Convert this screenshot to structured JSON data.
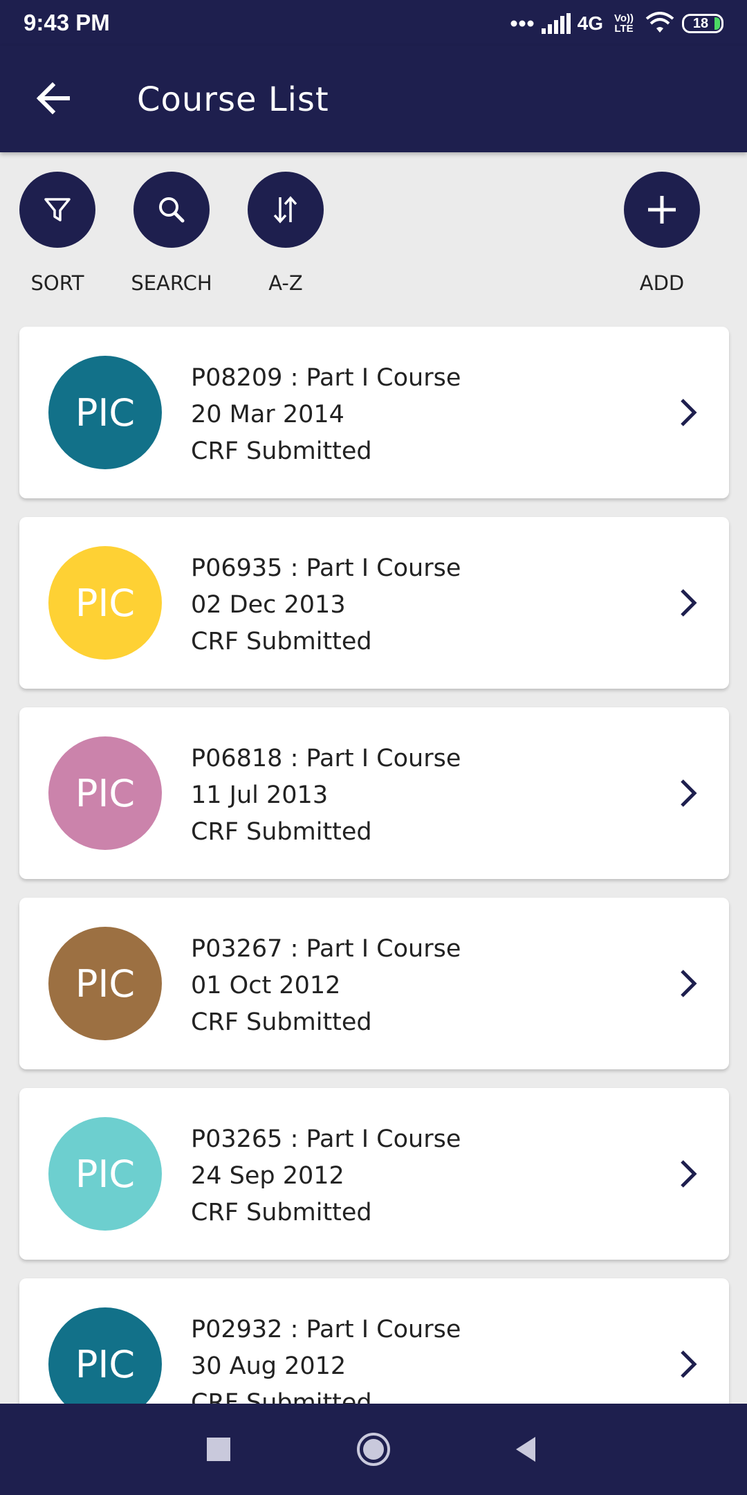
{
  "status_bar": {
    "time": "9:43 PM",
    "network": "4G",
    "network_sub": "Vo)) LTE",
    "battery": "18",
    "icons": [
      "dots-icon",
      "signal-icon",
      "wifi-icon",
      "battery-icon"
    ]
  },
  "app_bar": {
    "title": "Course List",
    "back_icon": "arrow-left-icon"
  },
  "toolbar": {
    "sort_label": "SORT",
    "search_label": "SEARCH",
    "az_label": "A-Z",
    "add_label": "ADD"
  },
  "courses": [
    {
      "avatar": "PIC",
      "avatar_color": "#127189",
      "title": "P08209 : Part I Course",
      "date": "20 Mar 2014",
      "status": "CRF Submitted"
    },
    {
      "avatar": "PIC",
      "avatar_color": "#fed134",
      "title": "P06935 : Part I Course",
      "date": "02 Dec 2013",
      "status": "CRF Submitted"
    },
    {
      "avatar": "PIC",
      "avatar_color": "#cb83ab",
      "title": "P06818 : Part I Course",
      "date": "11 Jul 2013",
      "status": "CRF Submitted"
    },
    {
      "avatar": "PIC",
      "avatar_color": "#9c7042",
      "title": "P03267 : Part I Course",
      "date": "01 Oct 2012",
      "status": "CRF Submitted"
    },
    {
      "avatar": "PIC",
      "avatar_color": "#6dcfcf",
      "title": "P03265 : Part I Course",
      "date": "24 Sep 2012",
      "status": "CRF Submitted"
    },
    {
      "avatar": "PIC",
      "avatar_color": "#127189",
      "title": "P02932 : Part I Course",
      "date": "30 Aug 2012",
      "status": "CRF Submitted"
    }
  ],
  "colors": {
    "primary": "#1e1f4e",
    "background": "#ebebeb",
    "card": "#ffffff"
  },
  "nav_bar": {
    "icons": [
      "recents-square-icon",
      "home-circle-icon",
      "back-triangle-icon"
    ]
  }
}
